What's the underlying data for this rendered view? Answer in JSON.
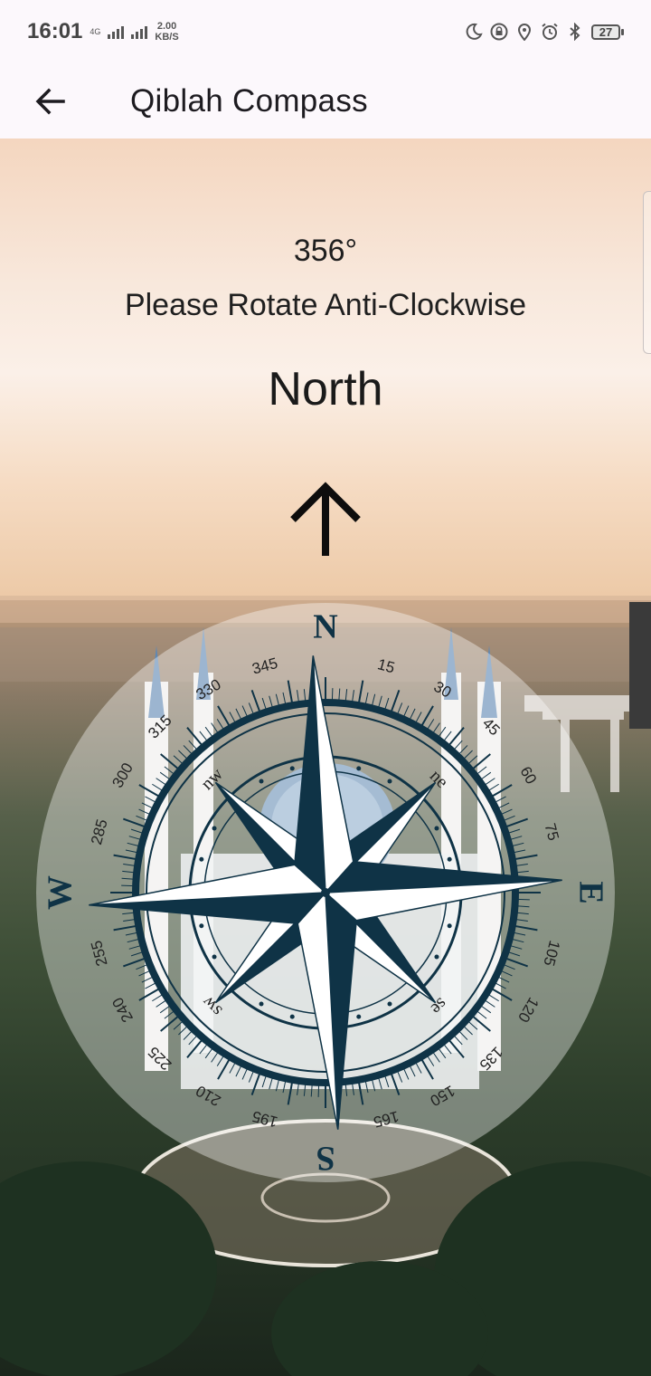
{
  "status_bar": {
    "time": "16:01",
    "network": "4G",
    "speed_value": "2.00",
    "speed_unit": "KB/S",
    "battery": "27",
    "icons": [
      "moon-icon",
      "lock-icon",
      "location-icon",
      "alarm-icon",
      "bluetooth-icon"
    ]
  },
  "app_bar": {
    "title": "Qiblah Compass",
    "back_icon": "arrow-left-icon"
  },
  "qiblah": {
    "degree": "356°",
    "instruction": "Please Rotate Anti-Clockwise",
    "direction": "North",
    "arrow_icon": "arrow-up-icon"
  },
  "compass": {
    "cardinals": [
      "N",
      "E",
      "S",
      "W"
    ],
    "intercardinals": [
      "nw",
      "ne",
      "se",
      "sw"
    ],
    "bearings": [
      "15",
      "30",
      "45",
      "60",
      "75",
      "105",
      "120",
      "135",
      "150",
      "165",
      "195",
      "210",
      "225",
      "240",
      "255",
      "285",
      "300",
      "315",
      "330",
      "345"
    ],
    "needle_color": "#0f3346",
    "face_color": "#ffffff"
  }
}
